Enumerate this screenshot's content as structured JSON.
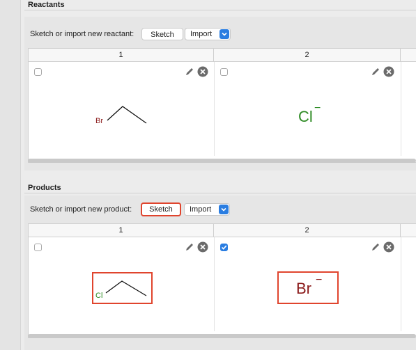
{
  "reactants": {
    "title": "Reactants",
    "row_label": "Sketch or import new reactant:",
    "sketch_label": "Sketch",
    "import_label": "Import",
    "columns": [
      "1",
      "2"
    ],
    "molecules": [
      {
        "atom_label": "Br",
        "checked": false
      },
      {
        "ion_label": "Cl",
        "charge": "−",
        "checked": false
      }
    ]
  },
  "products": {
    "title": "Products",
    "row_label": "Sketch or import new product:",
    "sketch_label": "Sketch",
    "import_label": "Import",
    "columns": [
      "1",
      "2"
    ],
    "molecules": [
      {
        "atom_label": "Cl",
        "checked": false
      },
      {
        "ion_label": "Br",
        "charge": "−",
        "checked": true
      }
    ]
  },
  "colors": {
    "accent": "#2a7de1",
    "highlight": "#e0442d",
    "bromine": "#8b1a1a",
    "chlorine": "#2e8b24"
  }
}
